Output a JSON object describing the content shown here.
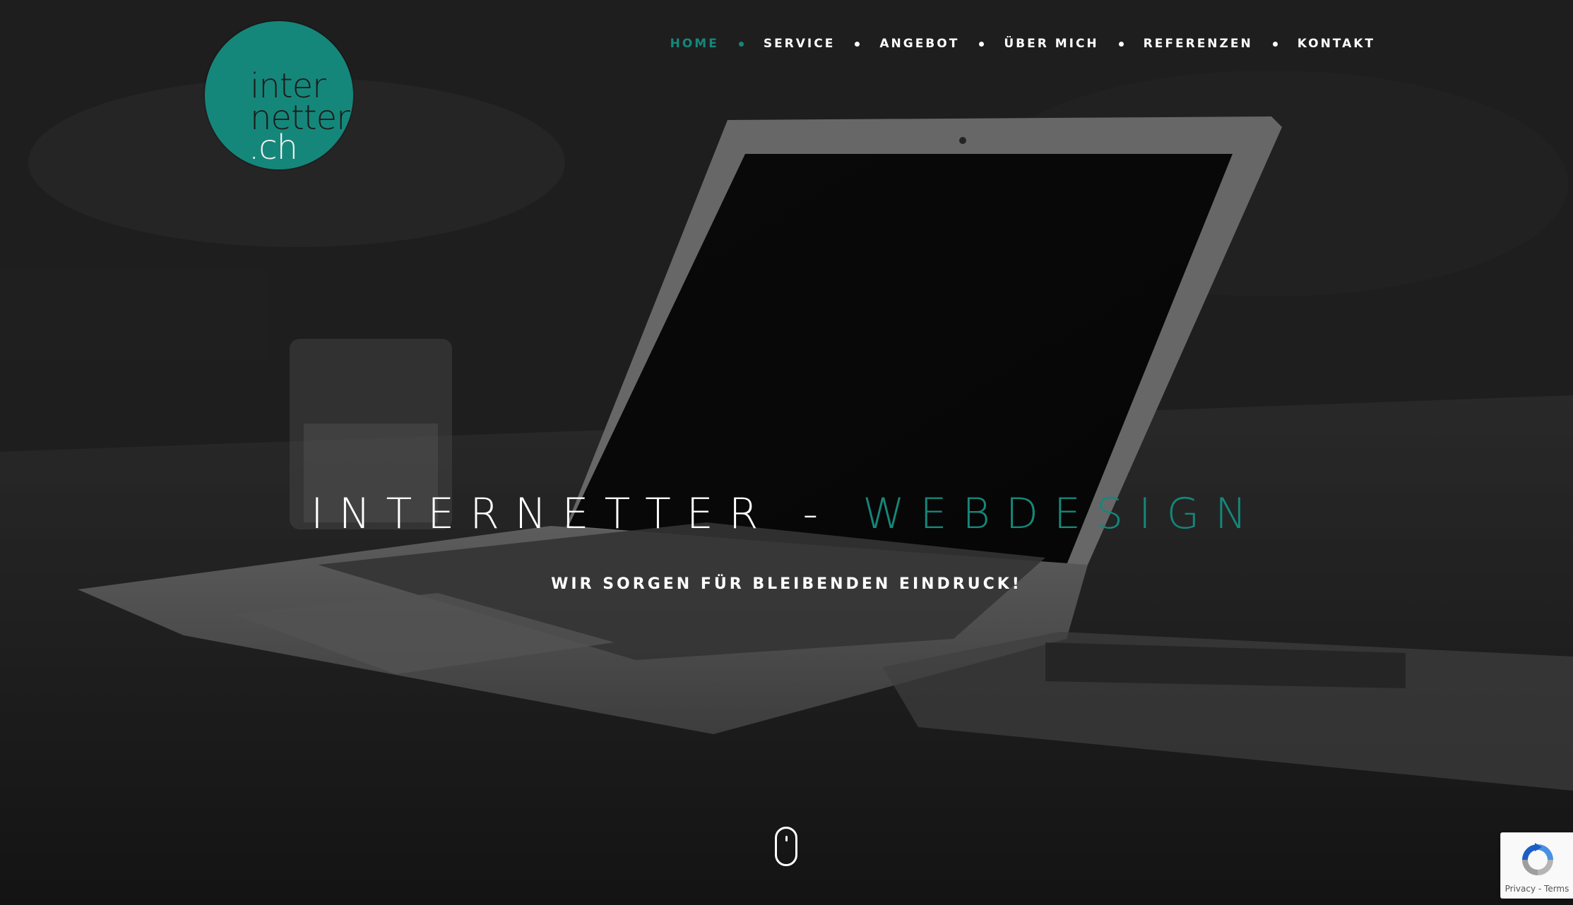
{
  "logo": {
    "line1": "inter",
    "line2": "netter",
    "line3": ".ch",
    "color": "#15877a"
  },
  "nav": {
    "items": [
      {
        "label": "HOME",
        "active": true
      },
      {
        "label": "SERVICE",
        "active": false
      },
      {
        "label": "ANGEBOT",
        "active": false
      },
      {
        "label": "ÜBER MICH",
        "active": false
      },
      {
        "label": "REFERENZEN",
        "active": false
      },
      {
        "label": "KONTAKT",
        "active": false
      }
    ],
    "active_color": "#15877a"
  },
  "hero": {
    "title_main": "INTERNETTER - ",
    "title_accent": "WEBDESIGN",
    "subtitle": "WIR SORGEN FÜR BLEIBENDEN EINDRUCK!",
    "scroll_icon": "mouse-scroll-icon"
  },
  "recaptcha": {
    "icon": "recaptcha-logo-icon",
    "text": "Privacy - Terms"
  }
}
